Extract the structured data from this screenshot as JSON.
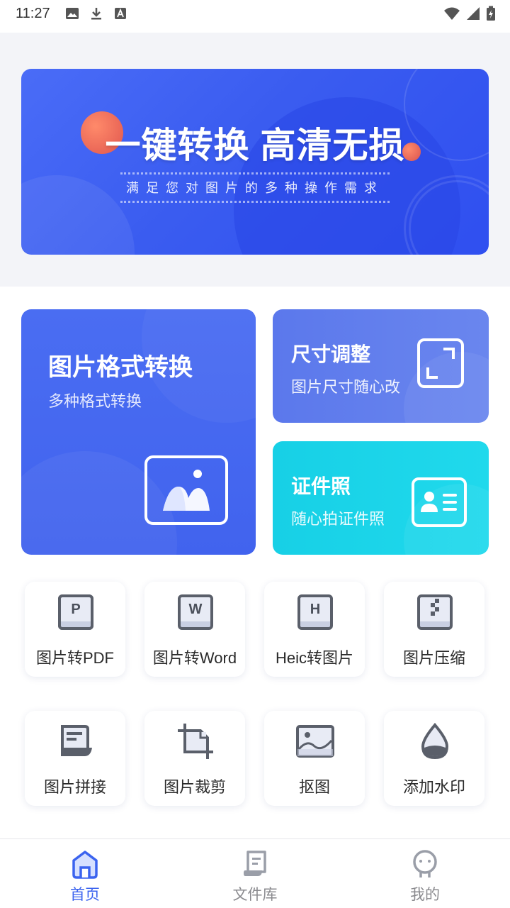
{
  "status_bar": {
    "time": "11:27"
  },
  "banner": {
    "title": "一键转换  高清无损",
    "subtitle": "满足您对图片的多种操作需求"
  },
  "feature_cards": {
    "main": {
      "title": "图片格式转换",
      "subtitle": "多种格式转换"
    },
    "size": {
      "title": "尺寸调整",
      "subtitle": "图片尺寸随心改"
    },
    "id_photo": {
      "title": "证件照",
      "subtitle": "随心拍证件照"
    }
  },
  "tools": [
    {
      "label": "图片转PDF",
      "icon": "pdf-icon",
      "glyph": "P"
    },
    {
      "label": "图片转Word",
      "icon": "word-icon",
      "glyph": "W"
    },
    {
      "label": "Heic转图片",
      "icon": "heic-icon",
      "glyph": "H"
    },
    {
      "label": "图片压缩",
      "icon": "compress-icon"
    },
    {
      "label": "图片拼接",
      "icon": "stitch-icon"
    },
    {
      "label": "图片裁剪",
      "icon": "crop-icon"
    },
    {
      "label": "抠图",
      "icon": "cutout-icon"
    },
    {
      "label": "添加水印",
      "icon": "watermark-icon"
    }
  ],
  "bottom_nav": {
    "items": [
      {
        "label": "首页",
        "icon": "home-icon",
        "active": true
      },
      {
        "label": "文件库",
        "icon": "file-library-icon",
        "active": false
      },
      {
        "label": "我的",
        "icon": "profile-icon",
        "active": false
      }
    ]
  },
  "colors": {
    "primary": "#3b63ef",
    "id_card": "#17d0e6",
    "icon_gray": "#7a7f89"
  }
}
